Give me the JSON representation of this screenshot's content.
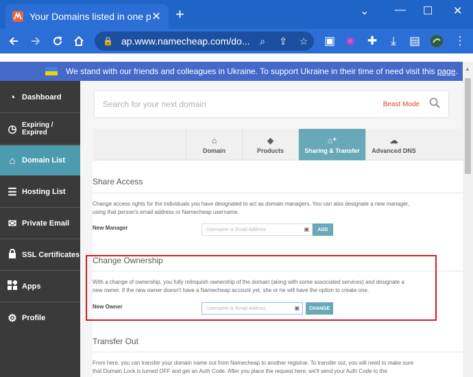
{
  "browser": {
    "tab_title": "Your Domains listed in one place",
    "tab_close": "✕",
    "new_tab": "+",
    "url": "ap.www.namecheap.com/do...",
    "window": {
      "minimize": "⌄",
      "min": "—",
      "max": "☐",
      "close": "✕"
    }
  },
  "banner": {
    "text": "We stand with our friends and colleagues in Ukraine. To support Ukraine in their time of need visit this ",
    "link": "page",
    "end": "."
  },
  "sidebar": {
    "items": [
      {
        "label": "Dashboard",
        "icon": "dashboard-icon"
      },
      {
        "label": "Expiring / Expired",
        "icon": "clock-icon"
      },
      {
        "label": "Domain List",
        "icon": "home-icon"
      },
      {
        "label": "Hosting List",
        "icon": "server-icon"
      },
      {
        "label": "Private Email",
        "icon": "envelope-icon"
      },
      {
        "label": "SSL Certificates",
        "icon": "lock-icon"
      },
      {
        "label": "Apps",
        "icon": "apps-icon"
      },
      {
        "label": "Profile",
        "icon": "gear-icon"
      }
    ],
    "active": "Domain List"
  },
  "search": {
    "placeholder": "Search for your next domain",
    "beast_mode": "Beast Mode"
  },
  "tabs": [
    {
      "label": "Domain",
      "icon": "home-icon"
    },
    {
      "label": "Products",
      "icon": "box-icon"
    },
    {
      "label": "Sharing & Transfer",
      "icon": "share-icon"
    },
    {
      "label": "Advanced DNS",
      "icon": "dns-icon"
    }
  ],
  "active_tab": "Sharing & Transfer",
  "share_access": {
    "title": "Share Access",
    "desc": "Change access rights for the individuals you have designated to act as domain managers. You can also designate a new manager, using that person's email address or Namecheap username.",
    "label": "New Manager",
    "placeholder": "Username or Email Address",
    "button": "ADD"
  },
  "change_ownership": {
    "title": "Change Ownership",
    "desc": "With a change of ownership, you fully relinquish ownership of the domain (along with some associated services) and designate a new owner. If the new owner doesn't have a Namecheap account yet, she or he will have the option to create one.",
    "label": "New Owner",
    "placeholder": "Username or Email Address",
    "button": "CHANGE"
  },
  "transfer_out": {
    "title": "Transfer Out",
    "desc": "From here, you can transfer your domain name out from Namecheap to another registrar. To transfer out, you will need to make sure that Domain Lock is turned OFF and get an Auth Code. After you place the request here, we'll send your Auth Code to the"
  }
}
